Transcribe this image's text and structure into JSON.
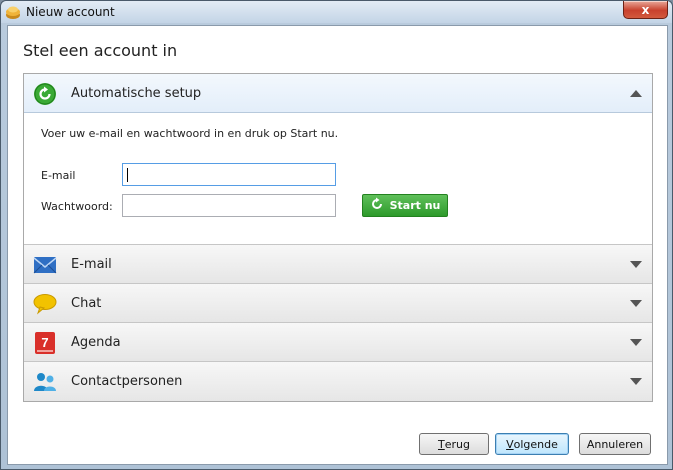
{
  "window": {
    "title": "Nieuw account",
    "close_label": "x"
  },
  "page": {
    "title": "Stel een account in"
  },
  "sections": [
    {
      "label": "Automatische setup",
      "icon": "refresh-icon",
      "expanded": true
    },
    {
      "label": "E-mail",
      "icon": "envelope-icon",
      "expanded": false
    },
    {
      "label": "Chat",
      "icon": "speech-bubble-icon",
      "expanded": false
    },
    {
      "label": "Agenda",
      "icon": "calendar-icon",
      "expanded": false
    },
    {
      "label": "Contactpersonen",
      "icon": "contacts-icon",
      "expanded": false
    }
  ],
  "setup": {
    "instructions": "Voer uw e-mail en wachtwoord in en druk op Start nu.",
    "email_label": "E-mail",
    "email_value": "",
    "password_label": "Wachtwoord:",
    "password_value": "",
    "start_label": "Start nu"
  },
  "footer": {
    "back_label_first": "T",
    "back_label_rest": "erug",
    "next_label_first": "V",
    "next_label_rest": "olgende",
    "cancel_label": "Annuleren"
  },
  "colors": {
    "accent_green": "#2d9a2b",
    "title_bar": "#c3d4e6",
    "close_red": "#c8412d",
    "calendar_red": "#d9302a",
    "chat_yellow": "#f2c200",
    "mail_blue": "#2f6fc4"
  }
}
